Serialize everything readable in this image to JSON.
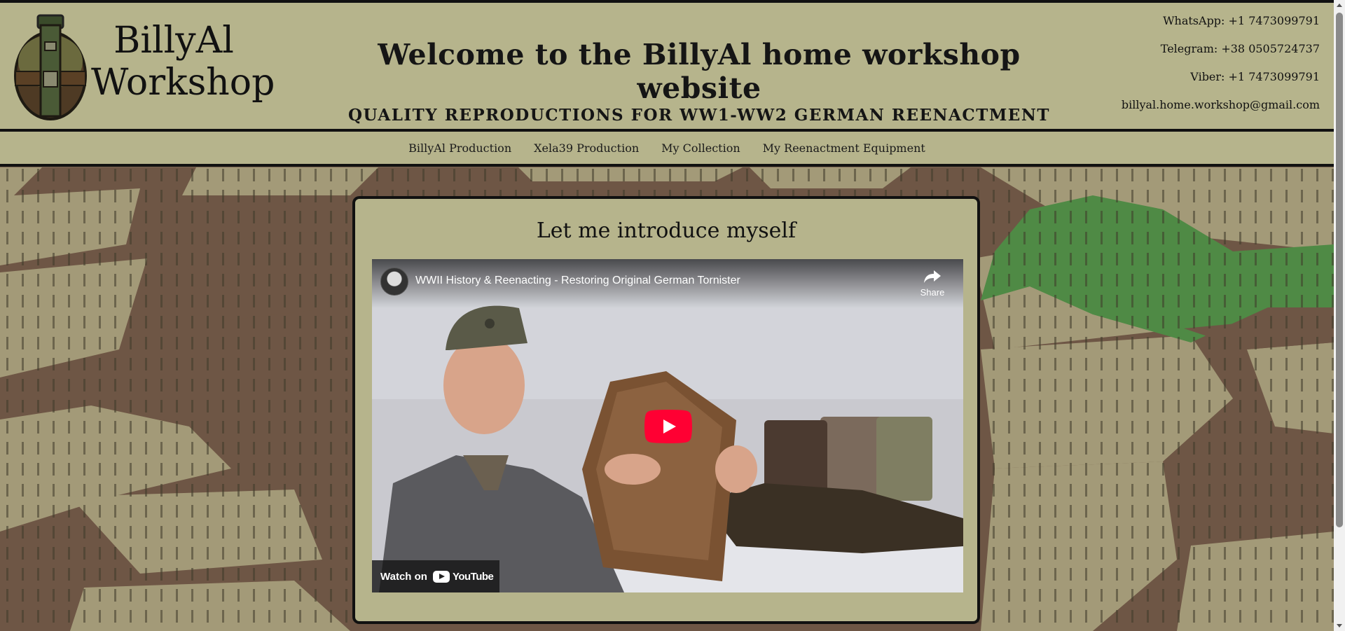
{
  "site": {
    "brand_line1": "BillyAl",
    "brand_line2": "Workshop",
    "headline": "Welcome to the BillyAl home workshop website",
    "subheadline": "QUALITY REPRODUCTIONS FOR WW1-WW2 GERMAN REENACTMENT"
  },
  "contacts": {
    "whatsapp": "WhatsApp: +1 7473099791",
    "telegram": "Telegram: +38 0505724737",
    "viber": "Viber: +1 7473099791",
    "email": "billyal.home.workshop@gmail.com"
  },
  "nav": {
    "items": [
      {
        "label": "BillyAl Production"
      },
      {
        "label": "Xela39 Production"
      },
      {
        "label": "My Collection"
      },
      {
        "label": "My Reenactment Equipment"
      }
    ]
  },
  "intro": {
    "title": "Let me introduce myself"
  },
  "video": {
    "title": "WWII History & Reenacting - Restoring Original German Tornister",
    "share_label": "Share",
    "watch_on": "Watch on",
    "youtube_label": "YouTube"
  },
  "colors": {
    "panel": "#b6b48c",
    "border": "#111111",
    "camo_brown": "#6e5645",
    "camo_tan": "#a39a78",
    "camo_green": "#4f8a45",
    "youtube_red": "#ff0033"
  },
  "icons": {
    "logo": "canteen-logo-icon",
    "share": "share-arrow-icon",
    "play": "play-icon",
    "youtube": "youtube-logo-icon"
  }
}
